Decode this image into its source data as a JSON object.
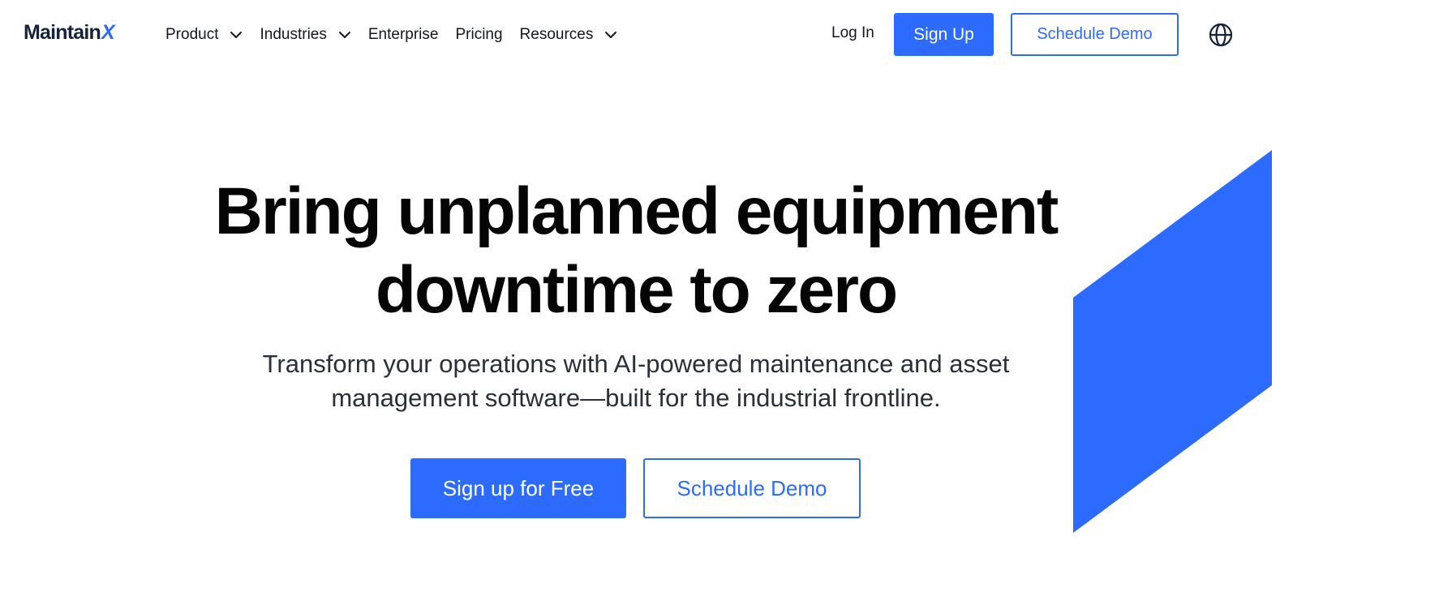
{
  "brand": {
    "name": "Maintain",
    "name_suffix": "X",
    "accent_color": "#2d6bff",
    "logo_color": "#14233c"
  },
  "nav": {
    "items": [
      {
        "label": "Product",
        "has_dropdown": true
      },
      {
        "label": "Industries",
        "has_dropdown": true
      },
      {
        "label": "Enterprise",
        "has_dropdown": false
      },
      {
        "label": "Pricing",
        "has_dropdown": false
      },
      {
        "label": "Resources",
        "has_dropdown": true
      }
    ],
    "dropdown_icon": "chevron-down-icon"
  },
  "header_actions": {
    "login_label": "Log In",
    "signup_label": "Sign Up",
    "demo_label": "Schedule Demo",
    "language_icon": "globe-icon"
  },
  "hero": {
    "title_line1": "Bring unplanned equipment",
    "title_line2": "downtime to zero",
    "subtitle_line1": "Transform your operations with AI-powered maintenance and asset",
    "subtitle_line2": "management software—built for the industrial frontline.",
    "primary_cta": "Sign up for Free",
    "secondary_cta": "Schedule Demo"
  }
}
